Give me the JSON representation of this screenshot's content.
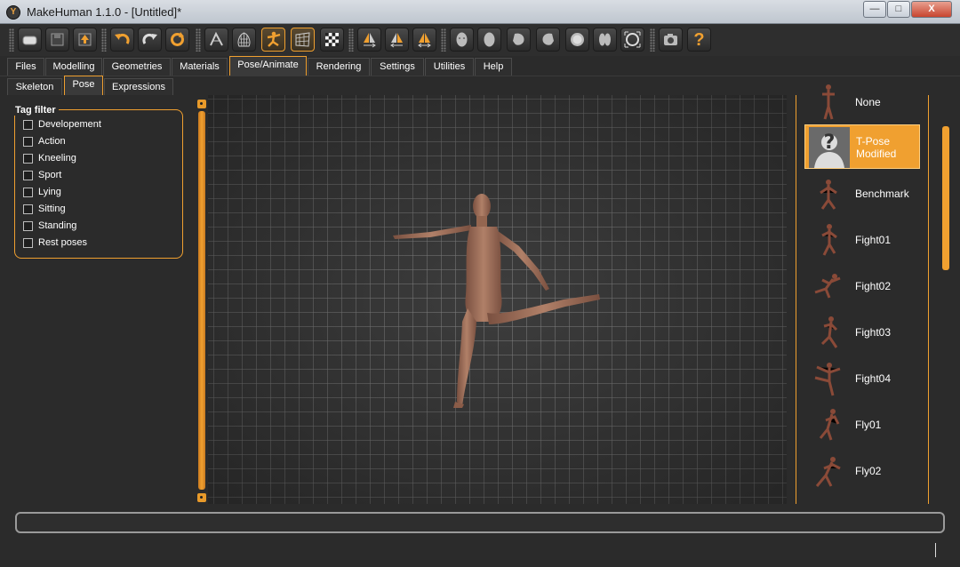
{
  "window": {
    "title": "MakeHuman 1.1.0 - [Untitled]*",
    "minimize_label": "—",
    "maximize_label": "□",
    "close_label": "X"
  },
  "toolbar": {
    "icons": [
      "new-icon",
      "save-icon",
      "export-icon",
      "undo-icon",
      "redo-icon",
      "reset-icon",
      "smooth-icon",
      "wireframe-icon",
      "pose-icon",
      "grid-icon",
      "background-icon",
      "symmetry-right-icon",
      "symmetry-left-icon",
      "symmetry-icon",
      "front-view-icon",
      "back-view-icon",
      "left-view-icon",
      "right-view-icon",
      "top-view-icon",
      "bottom-view-icon",
      "reset-camera-icon",
      "screenshot-icon",
      "help-icon"
    ],
    "active_icon": "pose-icon",
    "help_glyph": "?"
  },
  "tabs": [
    "Files",
    "Modelling",
    "Geometries",
    "Materials",
    "Pose/Animate",
    "Rendering",
    "Settings",
    "Utilities",
    "Help"
  ],
  "active_tab": "Pose/Animate",
  "subtabs": [
    "Skeleton",
    "Pose",
    "Expressions"
  ],
  "active_subtab": "Pose",
  "tag_filter": {
    "title": "Tag filter",
    "items": [
      "Developement",
      "Action",
      "Kneeling",
      "Sport",
      "Lying",
      "Sitting",
      "Standing",
      "Rest poses"
    ]
  },
  "poses": [
    {
      "label": "None",
      "selected": false
    },
    {
      "label": "T-Pose\nModified",
      "selected": true
    },
    {
      "label": "Benchmark",
      "selected": false
    },
    {
      "label": "Fight01",
      "selected": false
    },
    {
      "label": "Fight02",
      "selected": false
    },
    {
      "label": "Fight03",
      "selected": false
    },
    {
      "label": "Fight04",
      "selected": false
    },
    {
      "label": "Fly01",
      "selected": false
    },
    {
      "label": "Fly02",
      "selected": false
    }
  ],
  "colors": {
    "accent": "#f0a030",
    "background": "#2b2b2b",
    "viewport_grid": "#3a3a3a",
    "skin": "#a0705a"
  }
}
